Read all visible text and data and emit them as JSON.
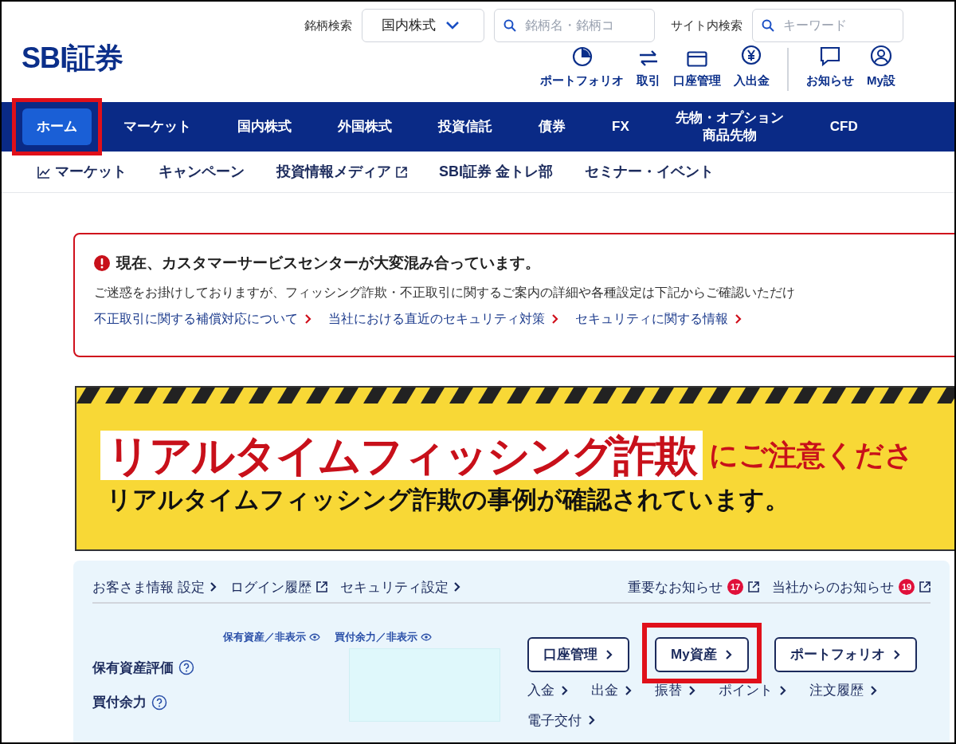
{
  "logo": "SBI証券",
  "header": {
    "stock_search_label": "銘柄検索",
    "market_select": "国内株式",
    "stock_search": {
      "placeholder": "銘柄名・銘柄コ"
    },
    "site_search_label": "サイト内検索",
    "site_search": {
      "placeholder": "キーワード"
    },
    "shortcuts": [
      {
        "label": "ポートフォリオ",
        "kind": "pie"
      },
      {
        "label": "取引",
        "kind": "exchange"
      },
      {
        "label": "口座管理",
        "kind": "card"
      },
      {
        "label": "入出金",
        "kind": "yen"
      },
      {
        "label": "お知らせ",
        "kind": "bubble"
      },
      {
        "label": "My設",
        "kind": "user"
      }
    ]
  },
  "main_nav": [
    {
      "label": "ホーム",
      "selected": true,
      "highlighted": true
    },
    {
      "label": "マーケット",
      "selected": false,
      "highlighted": false
    },
    {
      "label": "国内株式",
      "selected": false,
      "highlighted": false
    },
    {
      "label": "外国株式",
      "selected": false,
      "highlighted": false
    },
    {
      "label": "投資信託",
      "selected": false,
      "highlighted": false
    },
    {
      "label": "債券",
      "selected": false,
      "highlighted": false
    },
    {
      "label": "FX",
      "selected": false,
      "highlighted": false
    },
    {
      "lines": [
        "先物・オプション",
        "商品先物"
      ],
      "selected": false,
      "highlighted": false
    },
    {
      "label": "CFD",
      "selected": false,
      "highlighted": false
    }
  ],
  "sub_nav": [
    {
      "label": "マーケット",
      "kind": "chart"
    },
    {
      "label": "キャンペーン",
      "kind": "plain"
    },
    {
      "label": "投資情報メディア",
      "kind": "external"
    },
    {
      "label": "SBI証券 金トレ部",
      "kind": "plain"
    },
    {
      "label": "セミナー・イベント",
      "kind": "plain"
    }
  ],
  "alert": {
    "title": "現在、カスタマーサービスセンターが大変混み合っています。",
    "message": "ご迷惑をお掛けしておりますが、フィッシング詐欺・不正取引に関するご案内の詳細や各種設定は下記からご確認いただけ",
    "links": [
      "不正取引に関する補償対応について",
      "当社における直近のセキュリティ対策",
      "セキュリティに関する情報"
    ]
  },
  "banner": {
    "headline": "リアルタイムフィッシング詐欺",
    "headline_suffix": "にご注意くださ",
    "subline": "リアルタイムフィッシング詐欺の事例が確認されています。"
  },
  "account_panel": {
    "top_links": [
      {
        "label": "お客さま情報 設定",
        "kind": "arrow"
      },
      {
        "label": "ログイン履歴",
        "kind": "external"
      },
      {
        "label": "セキュリティ設定",
        "kind": "arrow"
      },
      {
        "label": "重要なお知らせ",
        "kind": "external",
        "badge": "17"
      },
      {
        "label": "当社からのお知らせ",
        "kind": "external",
        "badge": "19"
      }
    ],
    "visibility_toggles": [
      "保有資産／非表示",
      "買付余力／非表示"
    ],
    "rows": [
      "保有資産評価",
      "買付余力"
    ],
    "buttons": [
      {
        "label": "口座管理",
        "highlighted": false
      },
      {
        "label": "My資産",
        "highlighted": true
      },
      {
        "label": "ポートフォリオ",
        "highlighted": false
      }
    ],
    "links": [
      "入金",
      "出金",
      "振替",
      "ポイント",
      "注文履歴",
      "電子交付"
    ]
  }
}
